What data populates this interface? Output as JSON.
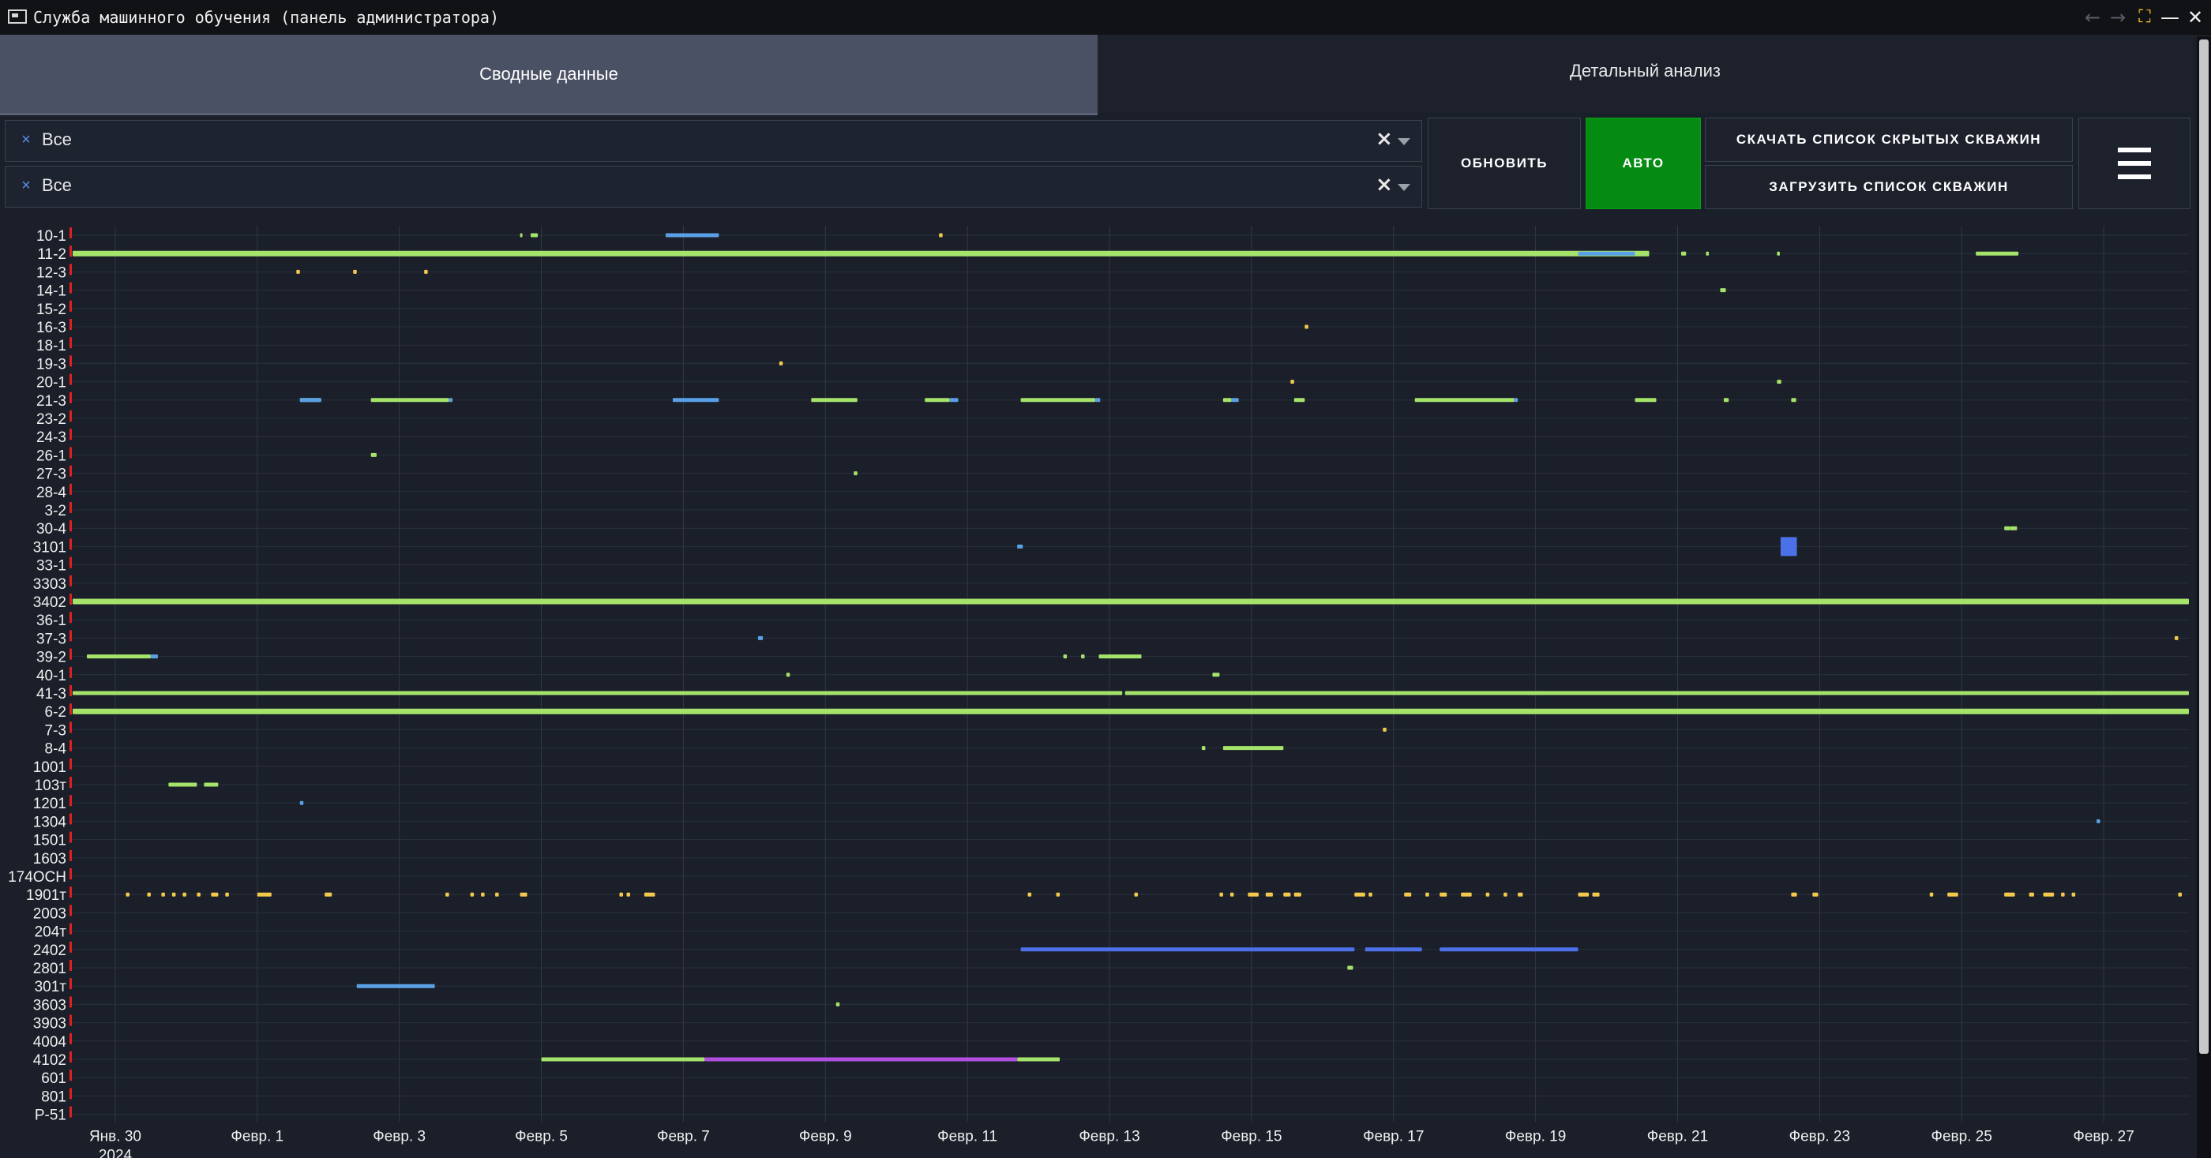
{
  "window": {
    "title": "Служба машинного обучения (панель администратора)",
    "icons": [
      "app-window-icon",
      "arrow-left-icon",
      "arrow-right-icon",
      "fullscreen-icon",
      "minimize-icon",
      "close-icon"
    ]
  },
  "tabs": [
    {
      "label": "Сводные данные",
      "active": true
    },
    {
      "label": "Детальный анализ",
      "active": false
    }
  ],
  "filters": [
    {
      "chip": "Все"
    },
    {
      "chip": "Все"
    }
  ],
  "buttons": {
    "refresh": "ОБНОВИТЬ",
    "auto": "АВТО",
    "download_hidden": "СКАЧАТЬ СПИСОК СКРЫТЫХ СКВАЖИН",
    "upload_list": "ЗАГРУЗИТЬ СПИСОК СКВАЖИН",
    "menu_icon": "hamburger-menu-icon"
  },
  "colors": {
    "background": "#1a1f29",
    "green": "#a6e36b",
    "blue": "#5aa0e6",
    "dark_blue": "#4c70e8",
    "yellow": "#f2c94c",
    "purple": "#b04fe0",
    "marker_red": "#e02020",
    "auto_button": "#058a12"
  },
  "chart_data": {
    "type": "timeline",
    "x_unit": "days since Jan 30, 2024",
    "xlim": [
      -0.6,
      29.2
    ],
    "tick_labels": [
      {
        "x": 0,
        "label": "Янв. 30",
        "sub": "2024"
      },
      {
        "x": 2,
        "label": "Февр. 1"
      },
      {
        "x": 4,
        "label": "Февр. 3"
      },
      {
        "x": 6,
        "label": "Февр. 5"
      },
      {
        "x": 8,
        "label": "Февр. 7"
      },
      {
        "x": 10,
        "label": "Февр. 9"
      },
      {
        "x": 12,
        "label": "Февр. 11"
      },
      {
        "x": 14,
        "label": "Февр. 13"
      },
      {
        "x": 16,
        "label": "Февр. 15"
      },
      {
        "x": 18,
        "label": "Февр. 17"
      },
      {
        "x": 20,
        "label": "Февр. 19"
      },
      {
        "x": 22,
        "label": "Февр. 21"
      },
      {
        "x": 24,
        "label": "Февр. 23"
      },
      {
        "x": 26,
        "label": "Февр. 25"
      },
      {
        "x": 28,
        "label": "Февр. 27"
      }
    ],
    "wells": [
      "10-1",
      "11-2",
      "12-3",
      "14-1",
      "15-2",
      "16-3",
      "18-1",
      "19-3",
      "20-1",
      "21-3",
      "23-2",
      "24-3",
      "26-1",
      "27-3",
      "28-4",
      "3-2",
      "30-4",
      "3101",
      "33-1",
      "3303",
      "3402",
      "36-1",
      "37-3",
      "39-2",
      "40-1",
      "41-3",
      "6-2",
      "7-3",
      "8-4",
      "1001",
      "103т",
      "1201",
      "1304",
      "1501",
      "1603",
      "174ОСН",
      "1901т",
      "2003",
      "204т",
      "2402",
      "2801",
      "301т",
      "3603",
      "3903",
      "4004",
      "4102",
      "601",
      "801",
      "Р-51"
    ],
    "grid": true,
    "series": [
      {
        "color": "green",
        "segments": [
          [
            "10-1",
            5.7,
            5.72
          ],
          [
            "10-1",
            5.85,
            5.95
          ],
          [
            "11-2",
            -0.6,
            21.6
          ],
          [
            "11-2",
            22.05,
            22.12
          ],
          [
            "11-2",
            22.4,
            22.44
          ],
          [
            "11-2",
            23.4,
            23.44
          ],
          [
            "11-2",
            26.2,
            26.8
          ],
          [
            "14-1",
            22.6,
            22.68
          ],
          [
            "20-1",
            23.4,
            23.46
          ],
          [
            "21-3",
            2.6,
            2.9
          ],
          [
            "21-3",
            3.6,
            4.7
          ],
          [
            "21-3",
            9.8,
            10.45
          ],
          [
            "21-3",
            11.4,
            11.75
          ],
          [
            "21-3",
            12.75,
            13.8
          ],
          [
            "21-3",
            15.6,
            15.72
          ],
          [
            "21-3",
            16.6,
            16.75
          ],
          [
            "21-3",
            18.3,
            19.7
          ],
          [
            "21-3",
            21.4,
            21.7
          ],
          [
            "21-3",
            22.65,
            22.72
          ],
          [
            "21-3",
            23.6,
            23.67
          ],
          [
            "26-1",
            3.6,
            3.68
          ],
          [
            "27-3",
            10.4,
            10.45
          ],
          [
            "30-4",
            26.6,
            26.68
          ],
          [
            "30-4",
            26.68,
            26.78
          ],
          [
            "3402",
            -0.6,
            29.2
          ],
          [
            "39-2",
            -0.4,
            0.5
          ],
          [
            "39-2",
            13.35,
            13.4
          ],
          [
            "39-2",
            13.6,
            13.65
          ],
          [
            "39-2",
            13.85,
            14.45
          ],
          [
            "40-1",
            9.45,
            9.5
          ],
          [
            "40-1",
            15.45,
            15.55
          ],
          [
            "41-3",
            -0.6,
            14.18
          ],
          [
            "41-3",
            14.22,
            29.2
          ],
          [
            "6-2",
            -0.6,
            29.2
          ],
          [
            "6-2",
            3.6,
            3.66
          ],
          [
            "6-2",
            13.5,
            13.55
          ],
          [
            "6-2",
            15.1,
            15.15
          ],
          [
            "6-2",
            17.4,
            17.46
          ],
          [
            "8-4",
            15.3,
            15.35
          ],
          [
            "8-4",
            15.6,
            16.45
          ],
          [
            "103т",
            0.75,
            1.15
          ],
          [
            "103т",
            1.25,
            1.45
          ],
          [
            "2801",
            17.35,
            17.43
          ],
          [
            "3603",
            10.15,
            10.2
          ],
          [
            "4102",
            6.0,
            8.3
          ],
          [
            "4102",
            12.7,
            13.3
          ]
        ]
      },
      {
        "color": "blue",
        "segments": [
          [
            "10-1",
            7.75,
            8.5
          ],
          [
            "11-2",
            20.6,
            21.4
          ],
          [
            "21-3",
            2.6,
            2.9
          ],
          [
            "21-3",
            4.7,
            4.75
          ],
          [
            "21-3",
            7.85,
            8.5
          ],
          [
            "21-3",
            11.75,
            11.87
          ],
          [
            "21-3",
            13.8,
            13.87
          ],
          [
            "21-3",
            15.72,
            15.82
          ],
          [
            "21-3",
            19.7,
            19.75
          ],
          [
            "3101",
            12.7,
            12.78
          ],
          [
            "39-2",
            0.5,
            0.6
          ],
          [
            "37-3",
            9.05,
            9.12
          ],
          [
            "1201",
            2.6,
            2.65
          ],
          [
            "1304",
            27.9,
            27.95
          ],
          [
            "301т",
            3.4,
            4.5
          ]
        ]
      },
      {
        "color": "dark_blue",
        "blocks": [
          [
            "3101",
            23.45,
            23.68
          ]
        ],
        "segments": [
          [
            "2402",
            12.75,
            17.45
          ],
          [
            "2402",
            17.6,
            18.4
          ],
          [
            "2402",
            18.65,
            20.6
          ]
        ]
      },
      {
        "color": "purple",
        "segments": [
          [
            "4102",
            8.3,
            12.7
          ]
        ]
      },
      {
        "color": "yellow",
        "segments": [
          [
            "10-1",
            11.6,
            11.65
          ],
          [
            "12-3",
            2.55,
            2.6
          ],
          [
            "12-3",
            3.35,
            3.4
          ],
          [
            "12-3",
            4.35,
            4.4
          ],
          [
            "16-3",
            16.75,
            16.8
          ],
          [
            "19-3",
            9.35,
            9.4
          ],
          [
            "20-1",
            16.55,
            16.6
          ],
          [
            "37-3",
            29.0,
            29.05
          ],
          [
            "7-3",
            17.85,
            17.9
          ],
          [
            "1901т",
            0.15,
            0.2
          ],
          [
            "1901т",
            0.45,
            0.5
          ],
          [
            "1901т",
            0.65,
            0.7
          ],
          [
            "1901т",
            0.8,
            0.85
          ],
          [
            "1901т",
            0.95,
            1.0
          ],
          [
            "1901т",
            1.15,
            1.2
          ],
          [
            "1901т",
            1.35,
            1.45
          ],
          [
            "1901т",
            1.55,
            1.6
          ],
          [
            "1901т",
            2.0,
            2.2
          ],
          [
            "1901т",
            2.95,
            3.05
          ],
          [
            "1901т",
            4.65,
            4.7
          ],
          [
            "1901т",
            5.0,
            5.05
          ],
          [
            "1901т",
            5.15,
            5.2
          ],
          [
            "1901т",
            5.35,
            5.4
          ],
          [
            "1901т",
            5.7,
            5.8
          ],
          [
            "1901т",
            7.1,
            7.15
          ],
          [
            "1901т",
            7.2,
            7.25
          ],
          [
            "1901т",
            7.45,
            7.6
          ],
          [
            "1901т",
            12.85,
            12.9
          ],
          [
            "1901т",
            13.25,
            13.3
          ],
          [
            "1901т",
            14.35,
            14.4
          ],
          [
            "1901т",
            15.55,
            15.6
          ],
          [
            "1901т",
            15.7,
            15.75
          ],
          [
            "1901т",
            15.95,
            16.1
          ],
          [
            "1901т",
            16.2,
            16.3
          ],
          [
            "1901т",
            16.45,
            16.55
          ],
          [
            "1901т",
            16.6,
            16.7
          ],
          [
            "1901т",
            17.45,
            17.6
          ],
          [
            "1901т",
            17.65,
            17.7
          ],
          [
            "1901т",
            18.15,
            18.25
          ],
          [
            "1901т",
            18.45,
            18.5
          ],
          [
            "1901т",
            18.65,
            18.75
          ],
          [
            "1901т",
            18.95,
            19.1
          ],
          [
            "1901т",
            19.3,
            19.35
          ],
          [
            "1901т",
            19.55,
            19.6
          ],
          [
            "1901т",
            19.75,
            19.82
          ],
          [
            "1901т",
            20.6,
            20.75
          ],
          [
            "1901т",
            20.8,
            20.9
          ],
          [
            "1901т",
            23.6,
            23.68
          ],
          [
            "1901т",
            23.9,
            23.98
          ],
          [
            "1901т",
            25.55,
            25.6
          ],
          [
            "1901т",
            25.8,
            25.95
          ],
          [
            "1901т",
            26.6,
            26.75
          ],
          [
            "1901т",
            26.95,
            27.02
          ],
          [
            "1901т",
            27.15,
            27.3
          ],
          [
            "1901т",
            27.4,
            27.45
          ],
          [
            "1901т",
            27.55,
            27.6
          ],
          [
            "1901т",
            29.05,
            29.1
          ]
        ]
      }
    ]
  }
}
